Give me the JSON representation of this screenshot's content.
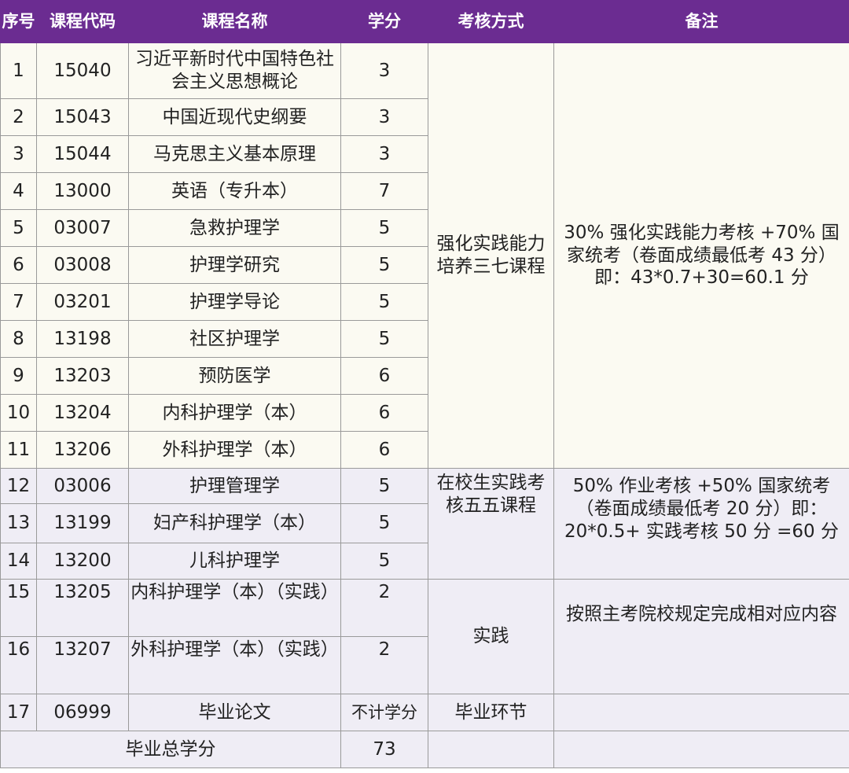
{
  "table": {
    "headers": [
      "序号",
      "课程代码",
      "课程名称",
      "学分",
      "考核方式",
      "备注"
    ],
    "rows": [
      {
        "no": "1",
        "code": "15040",
        "name": "习近平新时代中国特色社会主义思想概论",
        "credit": "3"
      },
      {
        "no": "2",
        "code": "15043",
        "name": "中国近现代史纲要",
        "credit": "3"
      },
      {
        "no": "3",
        "code": "15044",
        "name": "马克思主义基本原理",
        "credit": "3"
      },
      {
        "no": "4",
        "code": "13000",
        "name": "英语（专升本）",
        "credit": "7"
      },
      {
        "no": "5",
        "code": "03007",
        "name": "急救护理学",
        "credit": "5"
      },
      {
        "no": "6",
        "code": "03008",
        "name": "护理学研究",
        "credit": "5"
      },
      {
        "no": "7",
        "code": "03201",
        "name": "护理学导论",
        "credit": "5"
      },
      {
        "no": "8",
        "code": "13198",
        "name": "社区护理学",
        "credit": "5"
      },
      {
        "no": "9",
        "code": "13203",
        "name": "预防医学",
        "credit": "6"
      },
      {
        "no": "10",
        "code": "13204",
        "name": "内科护理学（本）",
        "credit": "6"
      },
      {
        "no": "11",
        "code": "13206",
        "name": "外科护理学（本）",
        "credit": "6"
      },
      {
        "no": "12",
        "code": "03006",
        "name": "护理管理学",
        "credit": "5"
      },
      {
        "no": "13",
        "code": "13199",
        "name": "妇产科护理学（本）",
        "credit": "5"
      },
      {
        "no": "14",
        "code": "13200",
        "name": "儿科护理学",
        "credit": "5"
      },
      {
        "no": "15",
        "code": "13205",
        "name": "内科护理学（本）（实践）",
        "credit": "2"
      },
      {
        "no": "16",
        "code": "13207",
        "name": "外科护理学（本）（实践）",
        "credit": "2"
      },
      {
        "no": "17",
        "code": "06999",
        "name": "毕业论文",
        "credit": "不计学分"
      }
    ],
    "groups": [
      {
        "method": "强化实践能力培养三七课程",
        "remark": "30% 强化实践能力考核 +70% 国家统考（卷面成绩最低考 43 分）即：43*0.7+30=60.1 分"
      },
      {
        "method": "在校生实践考核五五课程",
        "remark": "50% 作业考核 +50% 国家统考（卷面成绩最低考 20 分）即：20*0.5+ 实践考核 50 分 =60 分"
      },
      {
        "method": "实践",
        "remark": "按照主考院校规定完成相对应内容"
      },
      {
        "method": "毕业环节",
        "remark": ""
      }
    ],
    "total_label": "毕业总学分",
    "total_value": "73"
  },
  "colors": {
    "header_bg": "#6b2c91",
    "header_text": "#ffffff",
    "group1_bg": "#fbfaf2",
    "group2_bg": "#efedf5"
  }
}
